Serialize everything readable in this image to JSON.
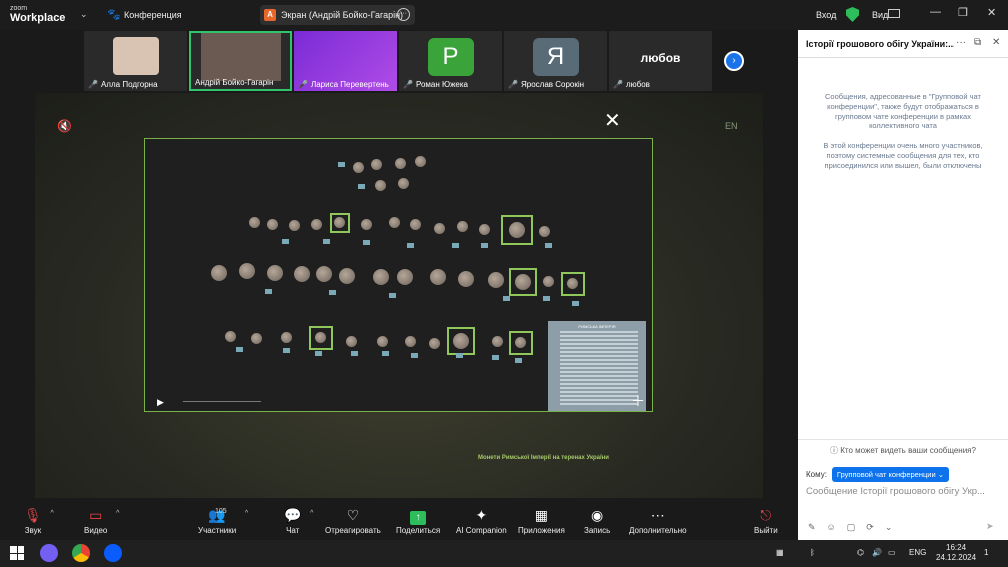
{
  "app": {
    "logo_small": "zoom",
    "logo_big": "Workplace",
    "meeting_label": "Конференция",
    "share_badge": "A",
    "share_title": "Экран (Андрій Бойко-Гагарін)",
    "enter_label": "Вход",
    "view_label": "Вид"
  },
  "participants": [
    {
      "name": "Алла Подгорна",
      "type": "photo"
    },
    {
      "name": "Андрій Бойко-Гагарін",
      "type": "photo"
    },
    {
      "name": "Лариса Перевертень",
      "type": "xmas"
    },
    {
      "name": "Роман Южека",
      "type": "letter",
      "letter": "Р",
      "color": "#3aa33a"
    },
    {
      "name": "Ярослав Сорокін",
      "type": "letter",
      "letter": "Я",
      "color": "#5a6b78"
    },
    {
      "name": "любов",
      "type": "text",
      "display": "любов"
    }
  ],
  "stage": {
    "corner_label": "EN",
    "legend_title": "РИМСЬКА ІМПЕРІЯ",
    "caption": "Монети Римської Імперії на теренах України"
  },
  "toolbar": {
    "audio": "Звук",
    "video": "Видео",
    "participants": "Участники",
    "participants_count": "105",
    "chat": "Чат",
    "react": "Отреагировать",
    "share": "Поделиться",
    "ai": "AI Companion",
    "apps": "Приложения",
    "record": "Запись",
    "more": "Дополнительно",
    "leave": "Выйти"
  },
  "chat": {
    "title": "Історії грошового обігу України:...",
    "notice_1": "Сообщения, адресованные в \"Групповой чат конференции\", также будут отображаться в групповом чате конференции в рамках коллективного чата",
    "notice_2": "В этой конференции очень много участников, поэтому системные сообщения для тех, кто присоединился или вышел, были отключены",
    "who_can_see": "Кто может видеть ваши сообщения?",
    "to_label": "Кому:",
    "to_value": "Групповой чат конференции",
    "input_placeholder": "Сообщение Історії грошового обігу Укр..."
  },
  "taskbar": {
    "lang": "ENG",
    "time": "16:24",
    "date": "24.12.2024",
    "notif": "1"
  }
}
